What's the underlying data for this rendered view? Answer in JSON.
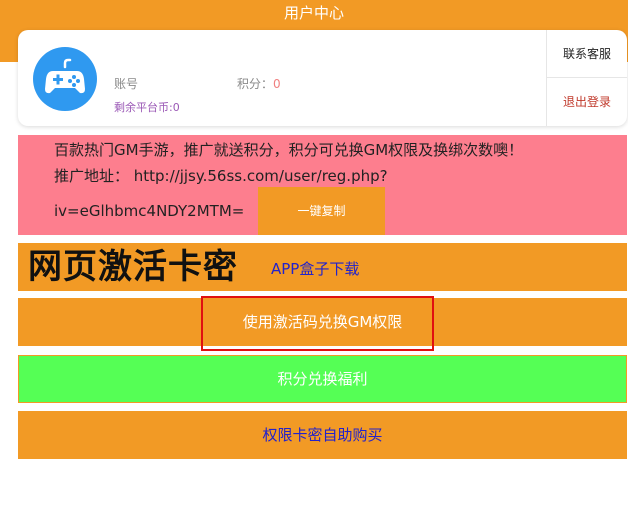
{
  "header": {
    "title": "用户中心",
    "color": "#f29a25"
  },
  "user_card": {
    "avatar_icon": "gamepad-icon",
    "account_label": "账号",
    "balance_label": "剩余平台币:0",
    "points_label": "积分：",
    "points_value": "0",
    "contact_label": "联系客服",
    "logout_label": "退出登录"
  },
  "promo": {
    "line1": "百款热门GM手游，推广就送积分，积分可兑换GM权限及换绑次数噢！",
    "line2": "推广地址： http://jjsy.56ss.com/user/reg.php?",
    "line3": "iv=eGlhbmc4NDY2MTM=",
    "copy_button": "一键复制",
    "color": "#fd7e8e"
  },
  "menu": {
    "download_logo": "网页激活卡密",
    "download_label": "APP盒子下载",
    "activate_label": "使用激活码兑换GM权限",
    "points_label": "积分兑换福利",
    "buy_label": "权限卡密自助购买"
  }
}
